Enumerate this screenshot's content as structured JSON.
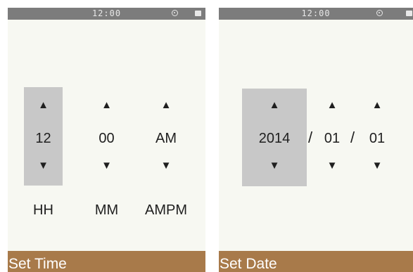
{
  "status": {
    "time": "12:00",
    "icons": [
      "wifi-icon",
      "battery-icon"
    ]
  },
  "set_time": {
    "columns": [
      {
        "value": "12",
        "label": "HH",
        "up": "▲",
        "down": "▼",
        "selected": true
      },
      {
        "value": "00",
        "label": "MM",
        "up": "▲",
        "down": "▼",
        "selected": false
      },
      {
        "value": "AM",
        "label": "AMPM",
        "up": "▲",
        "down": "▼",
        "selected": false
      }
    ],
    "footer_title": "Set Time"
  },
  "set_date": {
    "columns": [
      {
        "value": "2014",
        "up": "▲",
        "down": "▼",
        "selected": true
      },
      {
        "value": "01",
        "up": "▲",
        "down": "▼",
        "selected": false
      },
      {
        "value": "01",
        "up": "▲",
        "down": "▼",
        "selected": false
      }
    ],
    "separator": "/",
    "footer_title": "Set Date"
  },
  "colors": {
    "selected_bg": "#c8c8c8",
    "footer_bg": "#a87a4a",
    "statusbar_bg": "#7c7c7c",
    "screen_bg": "#f7f8f2"
  }
}
